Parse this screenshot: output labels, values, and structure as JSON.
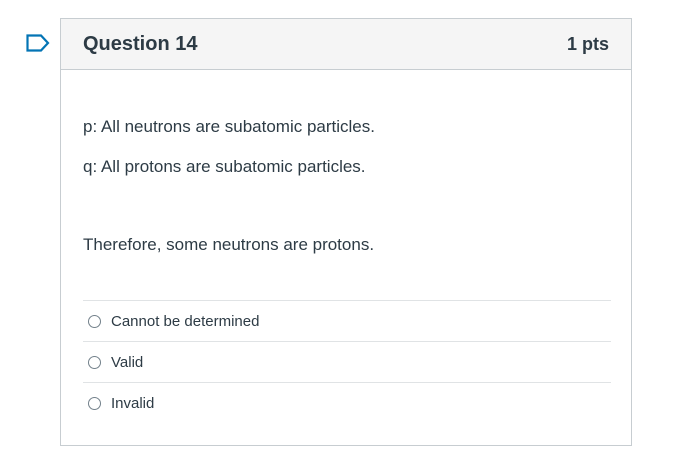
{
  "question": {
    "title": "Question 14",
    "points": "1 pts",
    "premise_p": "p: All neutrons are subatomic particles.",
    "premise_q": "q: All protons are subatomic particles.",
    "conclusion": "Therefore, some neutrons are protons."
  },
  "answers": [
    {
      "label": "Cannot be determined"
    },
    {
      "label": "Valid"
    },
    {
      "label": "Invalid"
    }
  ],
  "colors": {
    "flag_outline": "#0374b5",
    "header_bg": "#f5f5f5",
    "border": "#c7cdd1",
    "text": "#2d3b45"
  },
  "icons": {
    "flag": "flag-question-icon"
  }
}
